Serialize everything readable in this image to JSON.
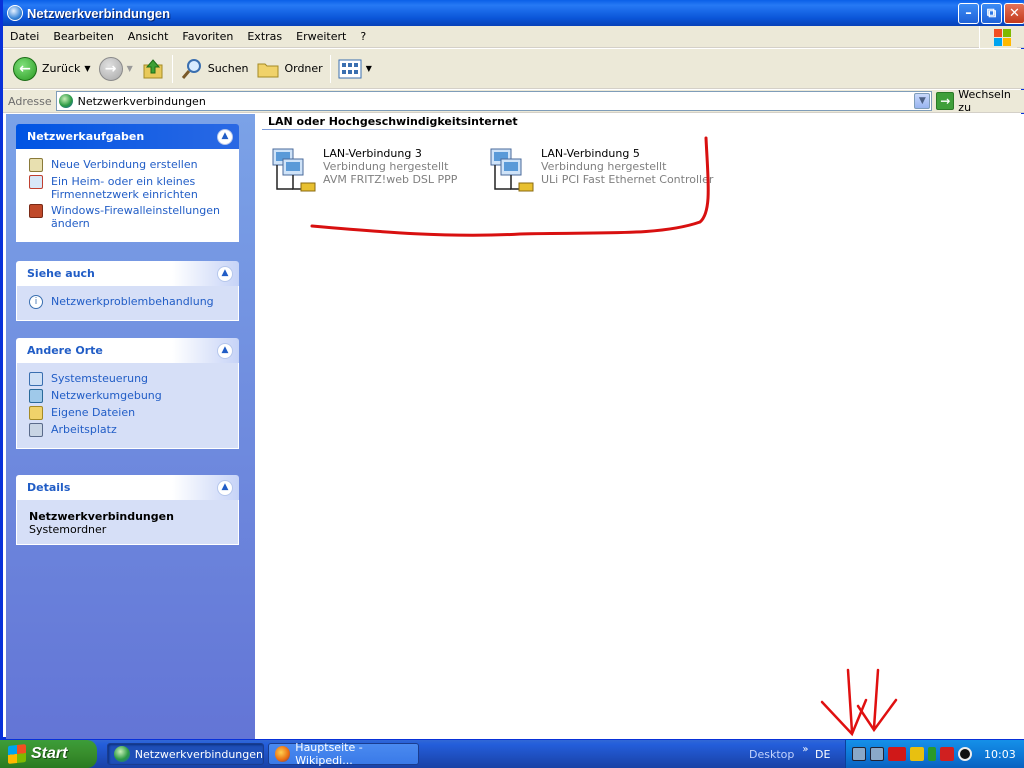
{
  "window": {
    "title": "Netzwerkverbindungen"
  },
  "menu": {
    "items": [
      "Datei",
      "Bearbeiten",
      "Ansicht",
      "Favoriten",
      "Extras",
      "Erweitert",
      "?"
    ]
  },
  "toolbar": {
    "back_label": "Zurück",
    "search_label": "Suchen",
    "folders_label": "Ordner"
  },
  "address": {
    "label": "Adresse",
    "value": "Netzwerkverbindungen",
    "go_label": "Wechseln zu"
  },
  "sidebar": {
    "network_tasks": {
      "title": "Netzwerkaufgaben",
      "items": [
        "Neue Verbindung erstellen",
        "Ein Heim- oder ein kleines Firmennetzwerk einrichten",
        "Windows-Firewalleinstellungen ändern"
      ]
    },
    "see_also": {
      "title": "Siehe auch",
      "items": [
        "Netzwerkproblembehandlung"
      ]
    },
    "other_places": {
      "title": "Andere Orte",
      "items": [
        "Systemsteuerung",
        "Netzwerkumgebung",
        "Eigene Dateien",
        "Arbeitsplatz"
      ]
    },
    "details": {
      "title": "Details",
      "name": "Netzwerkverbindungen",
      "type": "Systemordner"
    }
  },
  "main": {
    "group_title": "LAN oder Hochgeschwindigkeitsinternet",
    "connections": [
      {
        "name": "LAN-Verbindung 3",
        "status": "Verbindung hergestellt",
        "device": "AVM FRITZ!web DSL PPP"
      },
      {
        "name": "LAN-Verbindung 5",
        "status": "Verbindung hergestellt",
        "device": "ULi PCI Fast Ethernet Controller"
      }
    ]
  },
  "taskbar": {
    "start_label": "Start",
    "tasks": [
      "Netzwerkverbindungen",
      "Hauptseite - Wikipedi..."
    ],
    "desktop_label": "Desktop",
    "language": "DE",
    "clock": "10:03"
  },
  "colors": {
    "title_blue": "#0a55d8",
    "sidebar_blue": "#7ba2e7",
    "link_blue": "#215dc6",
    "annotation_red": "#d81010"
  }
}
